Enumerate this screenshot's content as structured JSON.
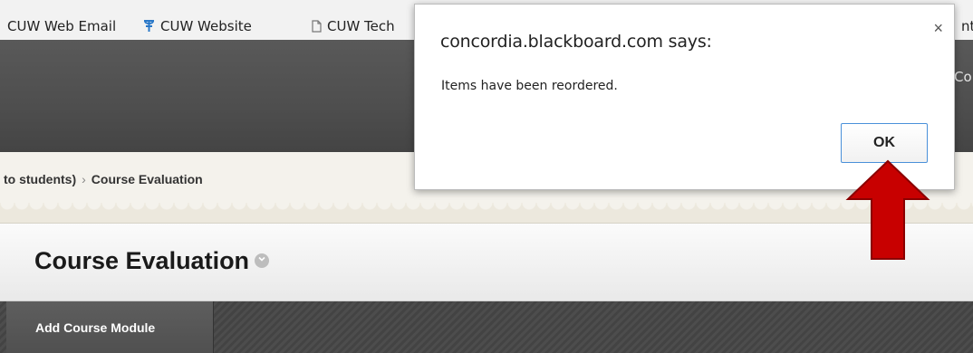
{
  "bookmarks": {
    "items": [
      {
        "label": "CUW Web Email",
        "icon": "none"
      },
      {
        "label": "CUW Website",
        "icon": "cuw-logo-icon"
      },
      {
        "label": "CUW Tech",
        "icon": "page-icon"
      }
    ],
    "right_fragment": "nt"
  },
  "header": {
    "peek_text": "Co"
  },
  "breadcrumb": {
    "parent": "to students)",
    "separator": "›",
    "current": "Course Evaluation"
  },
  "page": {
    "title": "Course Evaluation"
  },
  "actionbar": {
    "add_module_label": "Add Course Module"
  },
  "dialog": {
    "title": "concordia.blackboard.com says:",
    "message": "Items have been reordered.",
    "close_symbol": "×",
    "ok_label": "OK"
  },
  "colors": {
    "header_dark": "#4e4e4e",
    "breadcrumb_bg": "#f4f2ec",
    "ok_border": "#4a90d9",
    "annotation_arrow": "#c80000"
  }
}
